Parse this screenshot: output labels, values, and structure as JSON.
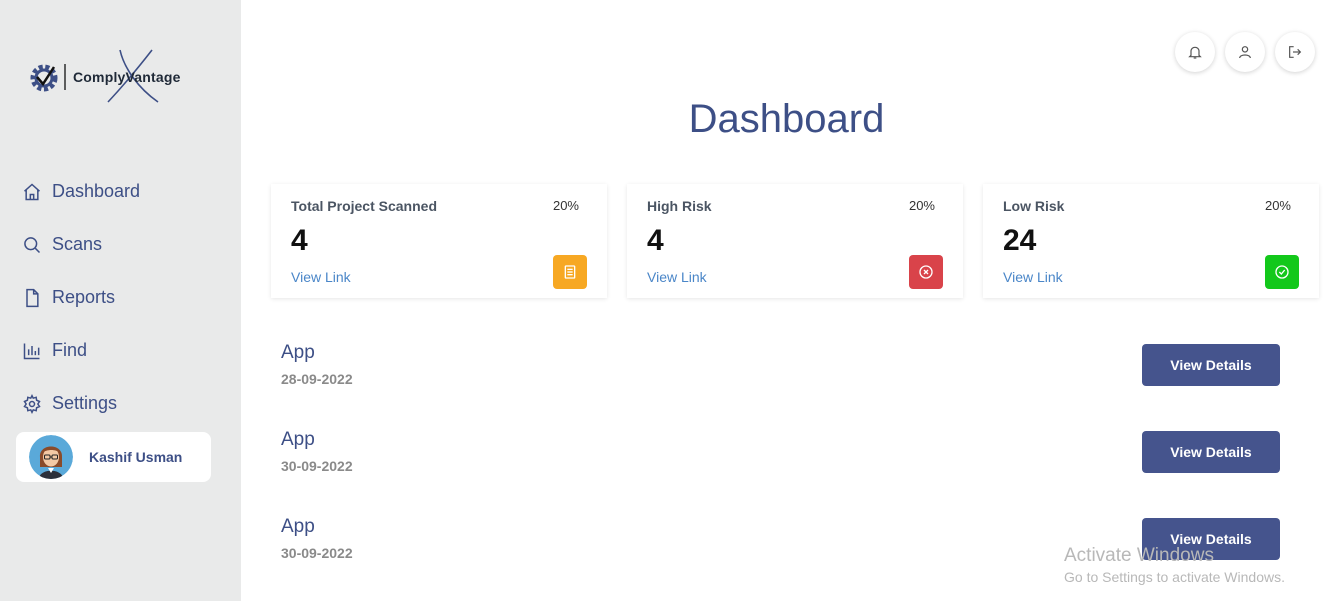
{
  "brand": {
    "logo_text_1": "Comply",
    "logo_text_2": "Vantage"
  },
  "sidebar": {
    "items": [
      {
        "label": "Dashboard",
        "icon": "home-icon"
      },
      {
        "label": "Scans",
        "icon": "search-icon"
      },
      {
        "label": "Reports",
        "icon": "file-icon"
      },
      {
        "label": "Find",
        "icon": "bar-chart-icon"
      },
      {
        "label": "Settings",
        "icon": "gear-icon"
      }
    ]
  },
  "user": {
    "name": "Kashif Usman"
  },
  "header": {
    "title": "Dashboard",
    "icons": [
      "bell-icon",
      "user-icon",
      "logout-icon"
    ]
  },
  "cards": [
    {
      "title": "Total Project Scanned",
      "percent": "20%",
      "value": "4",
      "link": "View Link",
      "badge_color": "#f7a823",
      "icon": "document-icon"
    },
    {
      "title": "High Risk",
      "percent": "20%",
      "value": "4",
      "link": "View Link",
      "badge_color": "#d9434a",
      "icon": "x-circle-icon"
    },
    {
      "title": "Low Risk",
      "percent": "20%",
      "value": "24",
      "link": "View Link",
      "badge_color": "#13c81b",
      "icon": "check-circle-icon"
    }
  ],
  "apps": [
    {
      "name": "App",
      "date": "28-09-2022",
      "button": "View Details"
    },
    {
      "name": "App",
      "date": "30-09-2022",
      "button": "View Details"
    },
    {
      "name": "App",
      "date": "30-09-2022",
      "button": "View Details"
    }
  ],
  "watermark": {
    "line1": "Activate Windows",
    "line2": "Go to Settings to activate Windows."
  },
  "colors": {
    "accent": "#3d4f86",
    "button": "#45548d",
    "sidebar_bg": "#e9eaea",
    "link": "#4a86c8"
  }
}
